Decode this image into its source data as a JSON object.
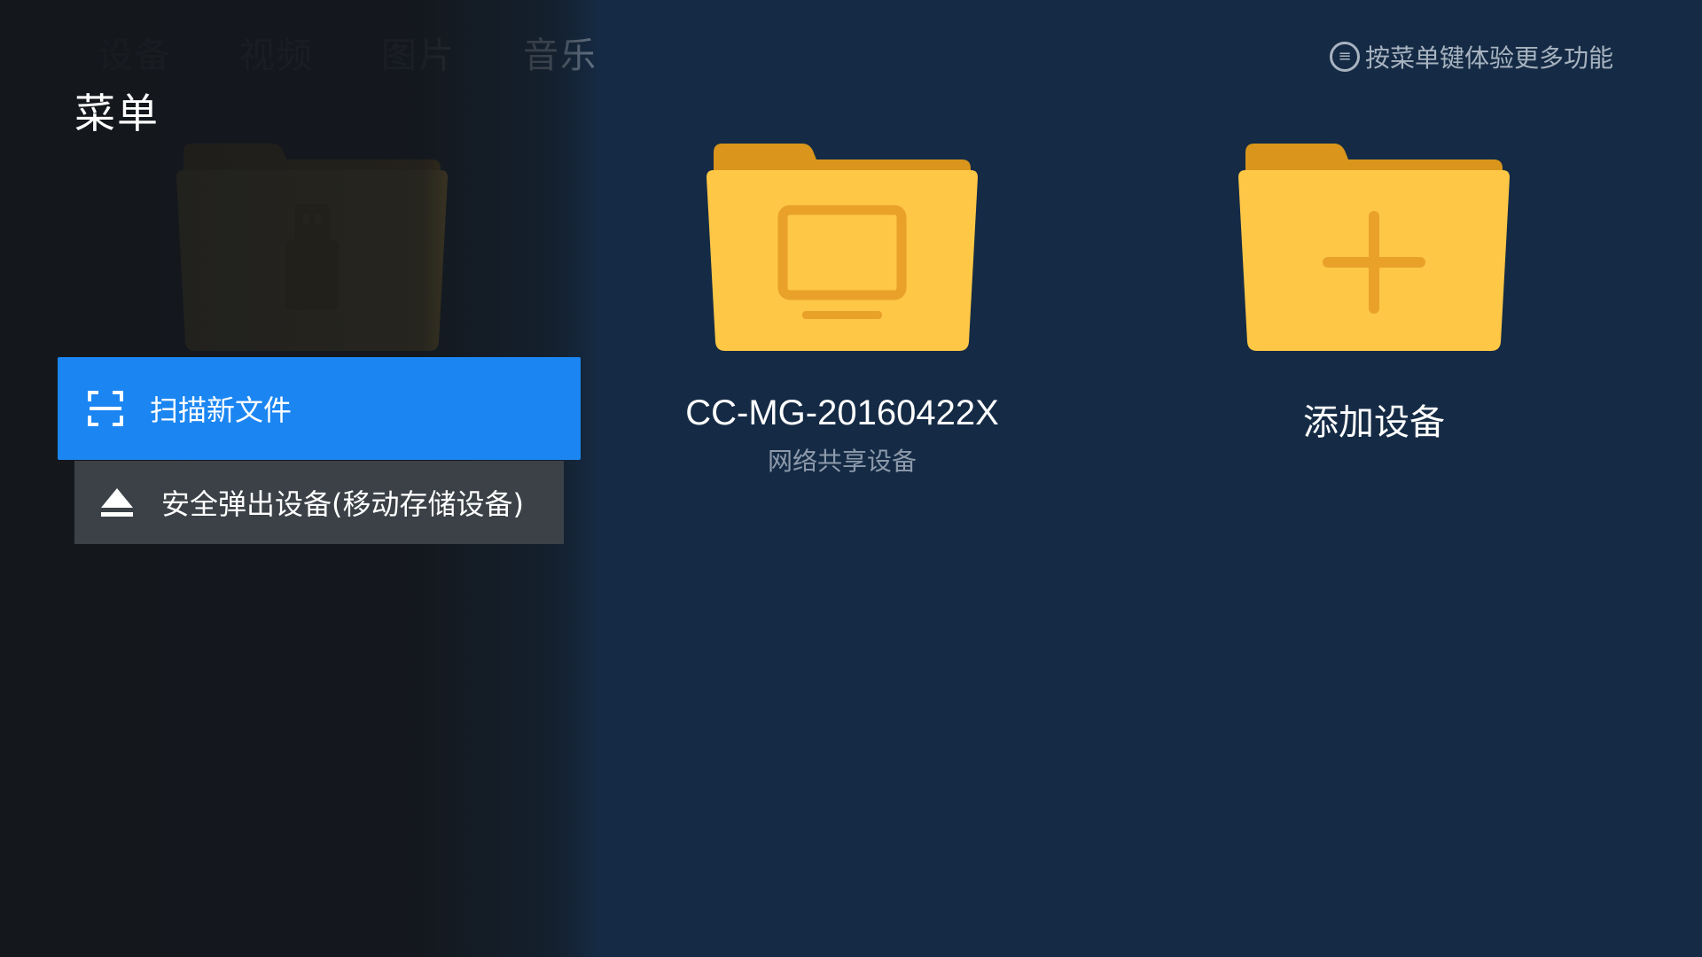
{
  "tabs": [
    "设备",
    "视频",
    "图片",
    "音乐"
  ],
  "hint": {
    "icon": "menu-circle-icon",
    "text": "按菜单键体验更多功能"
  },
  "devices": [
    {
      "name": "",
      "subtitle": "",
      "icon": "usb-icon"
    },
    {
      "name": "CC-MG-20160422X",
      "subtitle": "网络共享设备",
      "icon": "monitor-icon"
    },
    {
      "name": "添加设备",
      "subtitle": "",
      "icon": "plus-icon"
    }
  ],
  "menu": {
    "title": "菜单",
    "items": [
      {
        "label": "扫描新文件",
        "icon": "scan-frame-icon",
        "state": "focused"
      },
      {
        "label": "安全弹出设备(移动存储设备)",
        "icon": "eject-icon",
        "state": "normal"
      }
    ]
  },
  "colors": {
    "background": "#152b45",
    "folder_front": "#fec746",
    "folder_back": "#d9951c",
    "accent": "#1b86f2"
  }
}
